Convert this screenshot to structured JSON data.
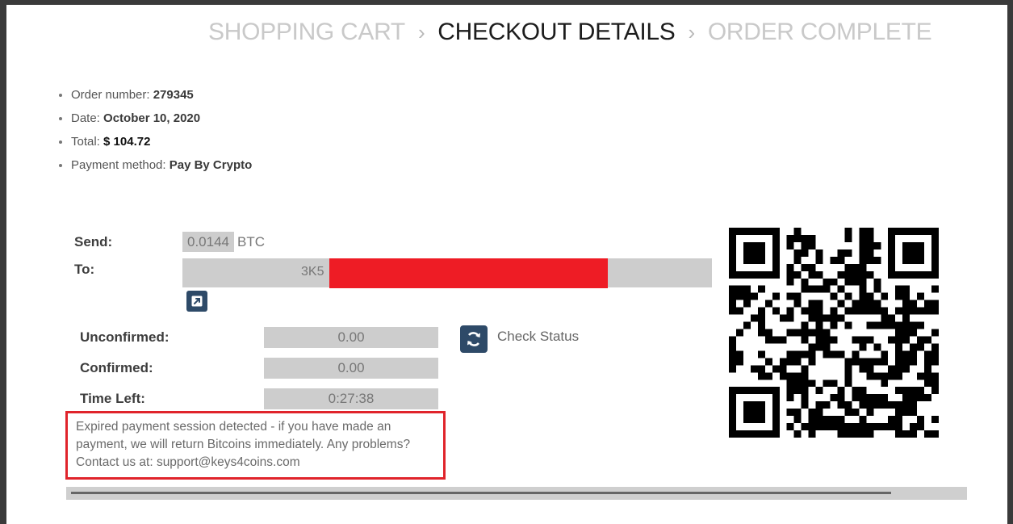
{
  "breadcrumb": {
    "step1": "SHOPPING CART",
    "sep1": "›",
    "step2": "CHECKOUT DETAILS",
    "sep2": "›",
    "step3": "ORDER COMPLETE"
  },
  "order": {
    "number_label": "Order number:",
    "number": "279345",
    "date_label": "Date:",
    "date": "October 10, 2020",
    "total_label": "Total:",
    "total": "$ 104.72",
    "method_label": "Payment method:",
    "method": "Pay By Crypto"
  },
  "payment": {
    "send_label": "Send:",
    "send_amount": "0.0144",
    "send_unit": "BTC",
    "to_label": "To:",
    "to_address_prefix": "3K5",
    "unconfirmed_label": "Unconfirmed:",
    "unconfirmed": "0.00",
    "confirmed_label": "Confirmed:",
    "confirmed": "0.00",
    "time_left_label": "Time Left:",
    "time_left": "0:27:38",
    "check_status_label": "Check Status",
    "expired_notice": "Expired payment session detected - if you have made an payment, we will return Bitcoins immediately. Any problems? Contact us at: support@keys4coins.com",
    "progress_fraction": 0.92
  },
  "icons": {
    "external_link": "external-link-icon",
    "refresh": "refresh-icon",
    "qr": "qr-code"
  },
  "colors": {
    "accent": "#2e4a68",
    "alert_border": "#e0242b",
    "redaction": "#ee1c25"
  }
}
